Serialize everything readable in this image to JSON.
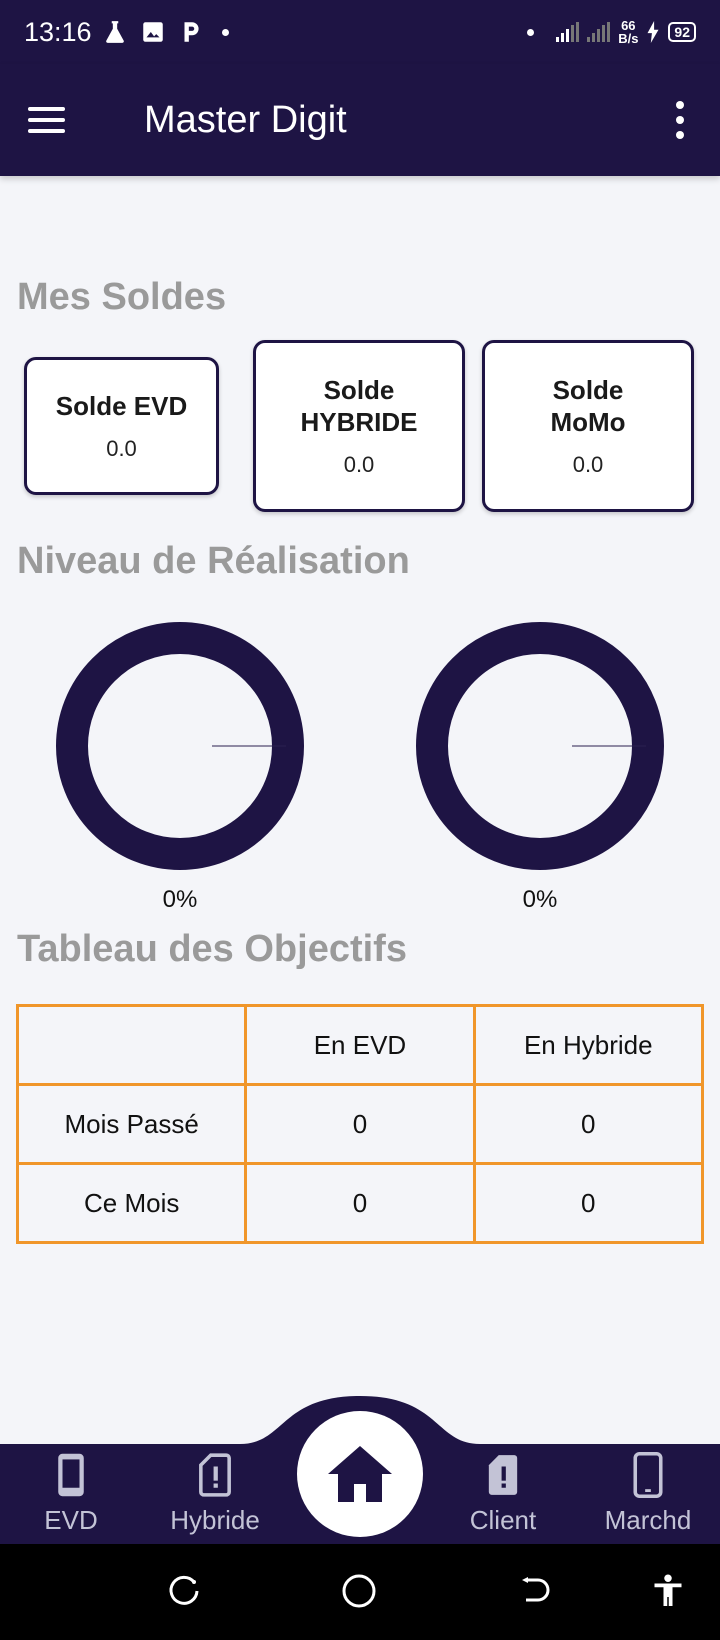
{
  "status_bar": {
    "time": "13:16",
    "net_speed_value": "66",
    "net_speed_unit": "B/s",
    "battery": "92"
  },
  "app_bar": {
    "title": "Master Digit"
  },
  "balances": {
    "section_title": "Mes Soldes",
    "cards": [
      {
        "label": "Solde EVD",
        "value": "0.0"
      },
      {
        "label": "Solde HYBRIDE",
        "value": "0.0"
      },
      {
        "label": "Solde MoMo",
        "value": "0.0"
      }
    ]
  },
  "achievement": {
    "section_title": "Niveau de Réalisation",
    "gauges": [
      {
        "label": "0%",
        "percent": 0
      },
      {
        "label": "0%",
        "percent": 0
      }
    ]
  },
  "objectives": {
    "section_title": "Tableau des Objectifs",
    "headers": [
      "",
      "En EVD",
      "En Hybride"
    ],
    "rows": [
      [
        "Mois Passé",
        "0",
        "0"
      ],
      [
        "Ce Mois",
        "0",
        "0"
      ]
    ]
  },
  "bottom_nav": {
    "items": [
      {
        "label": "EVD",
        "icon": "phone-icon"
      },
      {
        "label": "Hybride",
        "icon": "sim-alert-icon"
      },
      {
        "label": "",
        "icon": "home-icon"
      },
      {
        "label": "Client",
        "icon": "sim-alert-filled-icon"
      },
      {
        "label": "Marchd",
        "icon": "phone-icon"
      }
    ]
  },
  "colors": {
    "primary": "#1e1444",
    "table_border": "#f0962a",
    "section_title": "#9a9a9a",
    "background": "#f4f5f9"
  }
}
